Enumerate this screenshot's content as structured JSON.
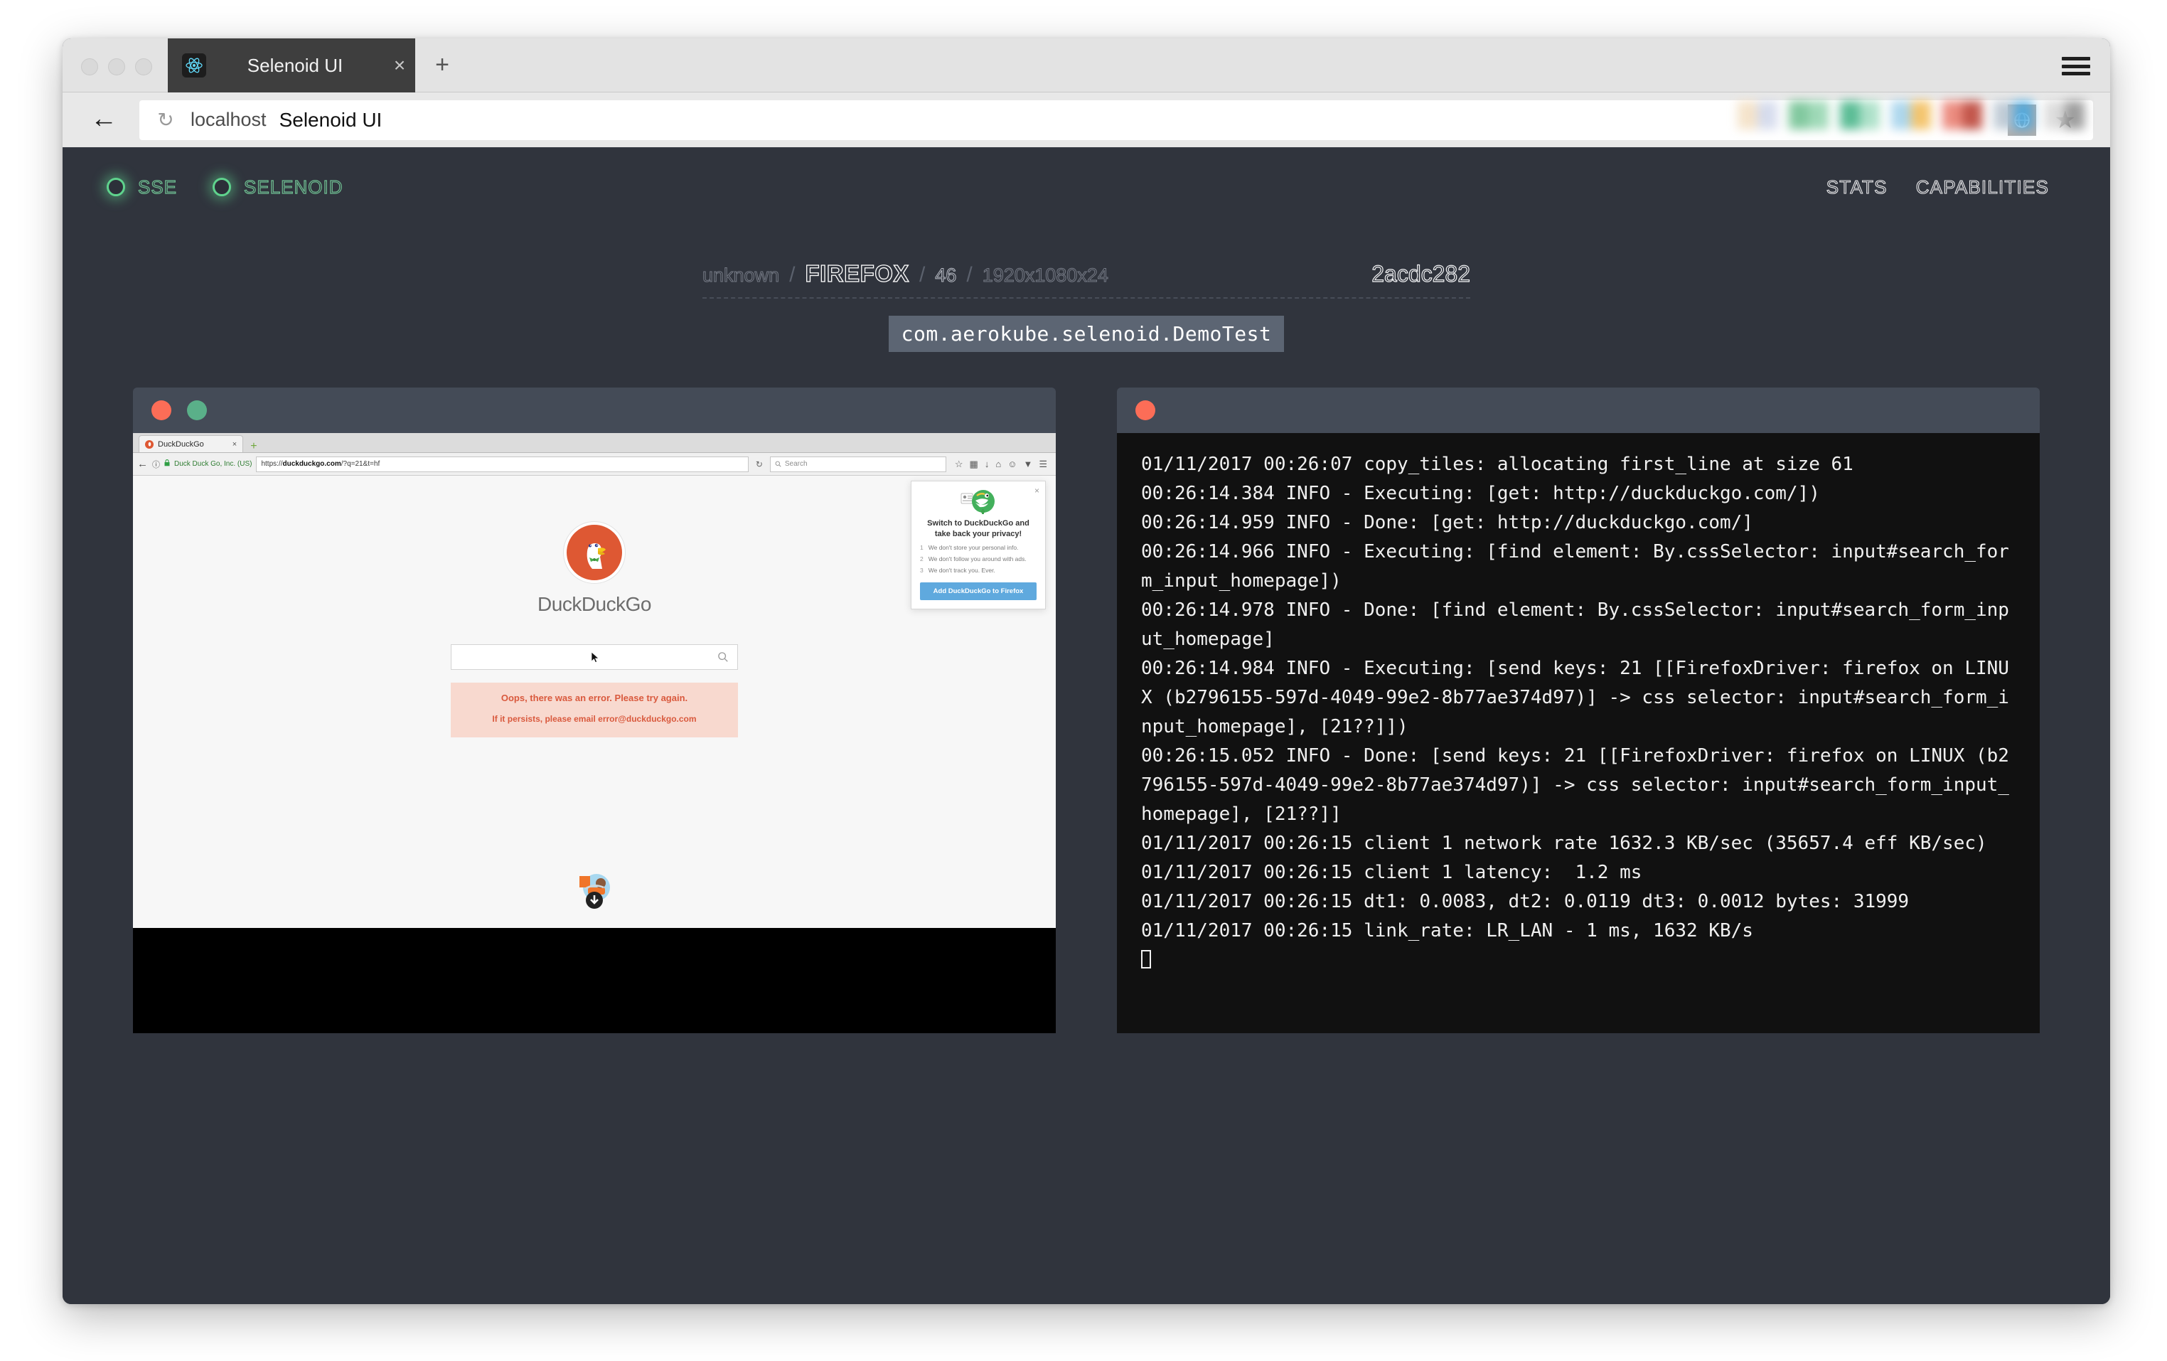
{
  "browser_chrome": {
    "tab": {
      "title": "Selenoid UI",
      "favicon": "react-atom-icon",
      "close": "×"
    },
    "new_tab": "+",
    "window_menu": "hamburger-menu-icon",
    "toolbar": {
      "back": "←",
      "reload": "↻",
      "url_host": "localhost",
      "url_title": "Selenoid UI",
      "globe": "globe-icon",
      "star": "★"
    }
  },
  "selenoid": {
    "status": [
      {
        "label": "SSE",
        "state_color": "#5fd38d"
      },
      {
        "label": "SELENOID",
        "state_color": "#5fd38d"
      }
    ],
    "nav": [
      {
        "label": "STATS"
      },
      {
        "label": "CAPABILITIES"
      }
    ],
    "session": {
      "platform": "unknown",
      "browser": "FIREFOX",
      "version": "46",
      "screen_resolution": "1920x1080x24",
      "session_id": "2acdc282",
      "test_name": "com.aerokube.selenoid.DemoTest",
      "separator": "/"
    }
  },
  "vnc_panel": {
    "dots": [
      "red",
      "green"
    ],
    "firefox": {
      "tab_label": "DuckDuckGo",
      "tab_close": "×",
      "new_tab": "+",
      "back": "←",
      "info": "ⓘ",
      "lock": "ὑ2",
      "identity": "Duck Duck Go, Inc. (US)",
      "url_prefix": "https://",
      "url_domain": "duckduckgo.com",
      "url_path": "/?q=21&t=hf",
      "reload": "↻",
      "search_placeholder": "Search",
      "toolbar_icons": [
        "star-icon",
        "library-icon",
        "download-icon",
        "home-icon",
        "pocket-icon",
        "shield-icon",
        "menu-icon"
      ]
    },
    "page": {
      "logo_name": "DuckDuckGo",
      "search_value": "",
      "search_icon": "magnifier-icon",
      "error_title": "Oops, there was an error.  Please try again.",
      "error_detail": "If it persists, please email error@duckduckgo.com"
    },
    "popup": {
      "close": "×",
      "title": "Switch to DuckDuckGo and take back your privacy!",
      "items": [
        {
          "n": "1",
          "text": "We don't store your personal info."
        },
        {
          "n": "2",
          "text": "We don't follow you around with ads."
        },
        {
          "n": "3",
          "text": "We don't track you. Ever."
        }
      ],
      "cta": "Add DuckDuckGo to Firefox"
    }
  },
  "log_panel": {
    "dots": [
      "red"
    ],
    "lines": [
      "01/11/2017 00:26:07 copy_tiles: allocating first_line at size 61",
      "00:26:14.384 INFO - Executing: [get: http://duckduckgo.com/])",
      "00:26:14.959 INFO - Done: [get: http://duckduckgo.com/]",
      "00:26:14.966 INFO - Executing: [find element: By.cssSelector: input#search_form_input_homepage])",
      "00:26:14.978 INFO - Done: [find element: By.cssSelector: input#search_form_input_homepage]",
      "00:26:14.984 INFO - Executing: [send keys: 21 [[FirefoxDriver: firefox on LINUX (b2796155-597d-4049-99e2-8b77ae374d97)] -> css selector: input#search_form_input_homepage], [21??]])",
      "00:26:15.052 INFO - Done: [send keys: 21 [[FirefoxDriver: firefox on LINUX (b2796155-597d-4049-99e2-8b77ae374d97)] -> css selector: input#search_form_input_homepage], [21??]]",
      "01/11/2017 00:26:15 client 1 network rate 1632.3 KB/sec (35657.4 eff KB/sec)",
      "01/11/2017 00:26:15 client 1 latency:  1.2 ms",
      "01/11/2017 00:26:15 dt1: 0.0083, dt2: 0.0119 dt3: 0.0012 bytes: 31999",
      "01/11/2017 00:26:15 link_rate: LR_LAN - 1 ms, 1632 KB/s"
    ]
  },
  "colors": {
    "page_bg": "#30343d",
    "panel_bar": "#444b57",
    "accent_green": "#5fd38d",
    "dot_red": "#fc6d57",
    "dot_green": "#5ab089",
    "badge_bg": "#5c6573",
    "log_bg": "#111111"
  }
}
